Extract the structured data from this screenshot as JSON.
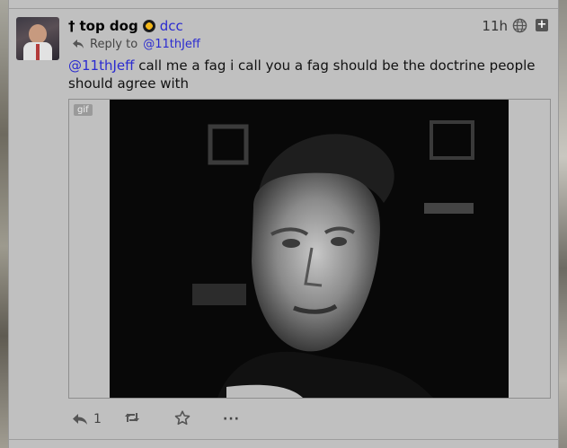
{
  "post": {
    "dagger": "†",
    "display_name": "top dog",
    "handle": "dcc",
    "timestamp": "11h",
    "reply_prefix": "Reply to",
    "reply_to": "@11thJeff",
    "mention": "@11thJeff",
    "text": " call me a fag i call you a fag should be the doctrine people should agree with",
    "media": {
      "badge": "gif"
    },
    "actions": {
      "reply_count": "1",
      "more": "···"
    }
  },
  "icons": {
    "flag": "anarchist-flag-icon",
    "visibility": "globe-icon",
    "expand": "expand-plus-icon",
    "reply_indicator": "reply-arrow-icon",
    "reply": "reply-icon",
    "boost": "boost-icon",
    "favorite": "star-icon",
    "more": "more-icon"
  }
}
